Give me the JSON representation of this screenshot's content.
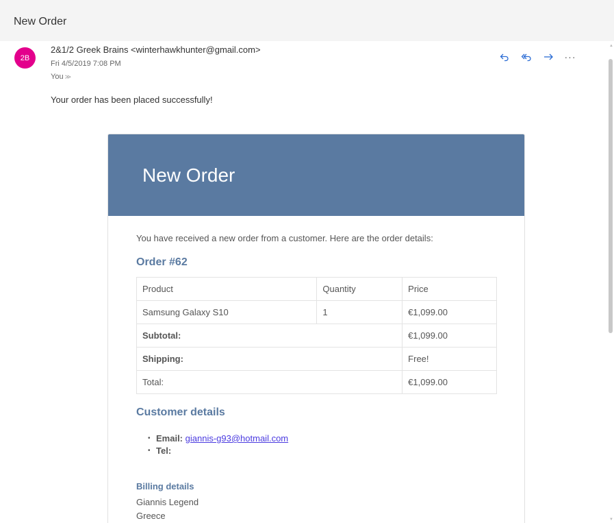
{
  "subject": "New Order",
  "message": {
    "avatar_initials": "2B",
    "avatar_color": "#e3008c",
    "sender": "2&1/2 Greek Brains <winterhawkhunter@gmail.com>",
    "date": "Fri 4/5/2019 7:08 PM",
    "to": "You",
    "actions": [
      {
        "name": "reply",
        "icon": "reply-icon"
      },
      {
        "name": "reply-all",
        "icon": "reply-all-icon"
      },
      {
        "name": "forward",
        "icon": "forward-icon"
      },
      {
        "name": "more",
        "icon": "more-icon",
        "label": "···"
      }
    ],
    "intro": "Your order has been placed successfully!"
  },
  "email": {
    "header_color": "#5a7aa1",
    "header_title": "New Order",
    "body_text": "You have received a new order from a customer. Here are the order details:",
    "order_heading": "Order #62",
    "table": {
      "headers": [
        "Product",
        "Quantity",
        "Price"
      ],
      "rows": [
        [
          "Samsung Galaxy S10",
          "1",
          "€1,099.00"
        ]
      ],
      "subtotal_label": "Subtotal:",
      "subtotal_value": "€1,099.00",
      "shipping_label": "Shipping:",
      "shipping_value": "Free!",
      "total_label": "Total:",
      "total_value": "€1,099.00"
    },
    "customer_heading": "Customer details",
    "email_label": "Email:",
    "email_value": "giannis-g93@hotmail.com",
    "tel_label": "Tel:",
    "billing_heading": "Billing details",
    "billing_name": "Giannis Legend",
    "billing_country": "Greece"
  }
}
